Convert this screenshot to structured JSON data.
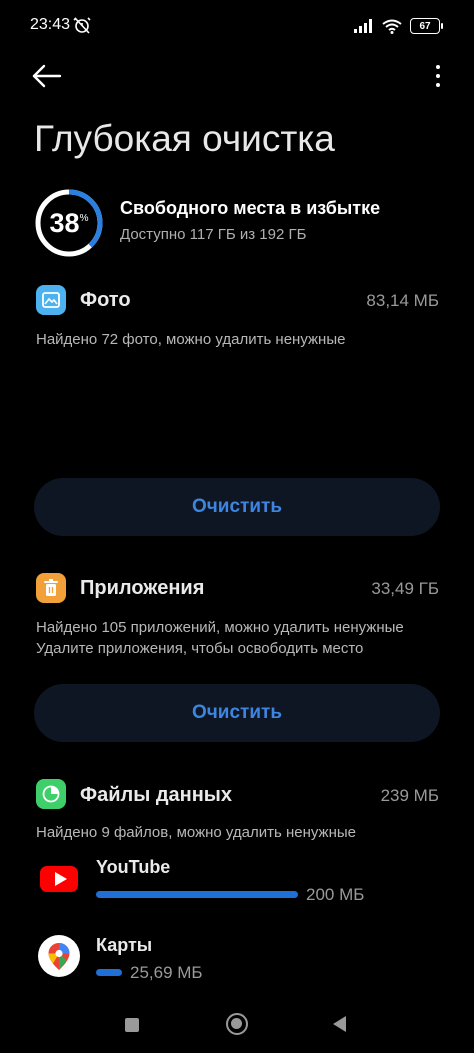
{
  "status_bar": {
    "time": "23:43",
    "battery": "67",
    "icons": [
      "alarm-off-icon",
      "signal-icon",
      "wifi-icon",
      "battery-icon"
    ]
  },
  "header": {
    "title": "Глубокая очистка",
    "back_icon": "arrow-left-icon",
    "menu_icon": "more-vertical-icon"
  },
  "storage": {
    "percent": "38",
    "percent_symbol": "%",
    "percent_value": 38,
    "title": "Свободного места в избытке",
    "subtitle": "Доступно 117 ГБ из 192 ГБ",
    "ring_color": "#2a7fe0"
  },
  "sections": {
    "photos": {
      "icon": "image-icon",
      "icon_color": "#4cb3f0",
      "title": "Фото",
      "size": "83,14 МБ",
      "description": "Найдено 72 фото, можно удалить ненужные",
      "button_label": "Очистить"
    },
    "apps": {
      "icon": "trash-icon",
      "icon_color": "#f2a03a",
      "title": "Приложения",
      "size": "33,49 ГБ",
      "description_line1": "Найдено 105 приложений, можно удалить ненужные",
      "description_line2": "Удалите приложения, чтобы освободить место",
      "button_label": "Очистить"
    },
    "data_files": {
      "icon": "pie-chart-icon",
      "icon_color": "#3ecf6a",
      "title": "Файлы данных",
      "size": "239 МБ",
      "description": "Найдено 9 файлов, можно удалить ненужные",
      "items": [
        {
          "name": "YouTube",
          "size": "200 МБ",
          "icon": "youtube-icon",
          "fraction": 1.0
        },
        {
          "name": "Карты",
          "size": "25,69 МБ",
          "icon": "google-maps-icon",
          "fraction": 0.13
        }
      ]
    }
  },
  "nav_bar": {
    "icons": [
      "recents-square-icon",
      "home-circle-icon",
      "back-triangle-icon"
    ]
  },
  "colors": {
    "accent": "#3c85e0",
    "background": "#000000",
    "button_bg": "#0d1622"
  }
}
